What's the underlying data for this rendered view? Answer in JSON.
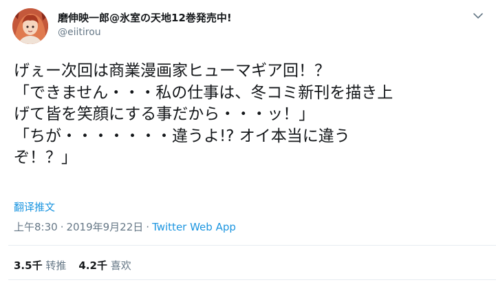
{
  "author": {
    "display_name": "磨伸映一郎@氷室の天地12巻発売中!",
    "handle": "@eiitirou"
  },
  "tweet": {
    "lines": [
      "げぇー次回は商業漫画家ヒューマギア回！？",
      "「できません・・・私の仕事は、冬コミ新刊を描き上",
      "げて皆を笑顔にする事だから・・・ッ！」",
      "「ちが・・・・・・・違うよ!? オイ本当に違う",
      "ぞ！？」"
    ],
    "translate_label": "翻译推文",
    "time": "上午8:30",
    "separator1": "·",
    "date": "2019年9月22日",
    "separator2": "·",
    "source_app": "Twitter Web App"
  },
  "stats": {
    "retweets_count": "3.5千",
    "retweets_label": "转推",
    "likes_count": "4.2千",
    "likes_label": "喜欢"
  },
  "colors": {
    "link": "#1b95e0",
    "muted": "#657786",
    "text": "#14171a",
    "divider": "#e6ecf0"
  },
  "icons": {
    "more": "chevron-down-icon",
    "avatar": "avatar-image"
  }
}
